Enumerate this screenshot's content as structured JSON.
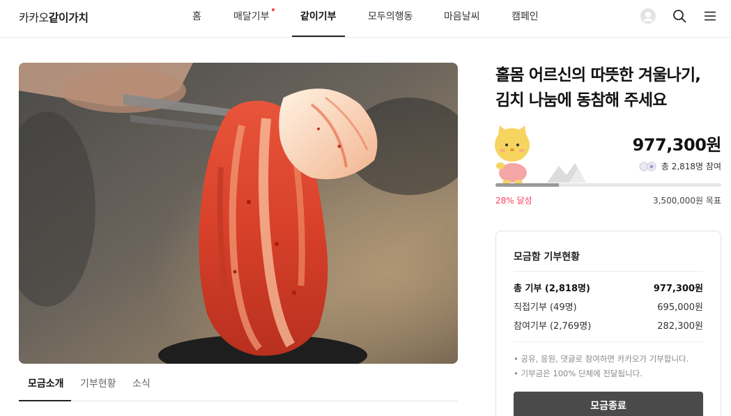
{
  "header": {
    "logo_light": "카카오",
    "logo_bold": "같이가치",
    "nav": [
      {
        "label": "홈"
      },
      {
        "label": "매달기부"
      },
      {
        "label": "같이기부"
      },
      {
        "label": "모두의행동"
      },
      {
        "label": "마음날씨"
      },
      {
        "label": "캠페인"
      }
    ],
    "active_nav": "같이기부"
  },
  "tabs": [
    {
      "label": "모금소개"
    },
    {
      "label": "기부현황"
    },
    {
      "label": "소식"
    }
  ],
  "campaign": {
    "title_line1": "홀몸 어르신의 따뜻한 겨울나기,",
    "title_line2": "김치 나눔에 동참해 주세요",
    "amount": "977,300원",
    "participants": "총 2,818명 참여",
    "percent_label": "28% 달성",
    "progress_fraction": 0.28,
    "goal": "3,500,000원 목표"
  },
  "donation_box": {
    "title": "모금함 기부현황",
    "rows": [
      {
        "label": "총 기부 (2,818명)",
        "value": "977,300원"
      },
      {
        "label": "직접기부 (49명)",
        "value": "695,000원"
      },
      {
        "label": "참여기부 (2,769명)",
        "value": "282,300원"
      }
    ],
    "notes": [
      "•  공유, 응원, 댓글로 참여하면 카카오가 기부합니다.",
      "•  기부금은 100% 단체에 전달됩니다."
    ],
    "button_label": "모금종료"
  },
  "colors": {
    "accent_red": "#ff3d5a",
    "button": "#4a4a4a"
  },
  "icons": [
    "user-avatar-icon",
    "search-icon",
    "menu-icon"
  ]
}
